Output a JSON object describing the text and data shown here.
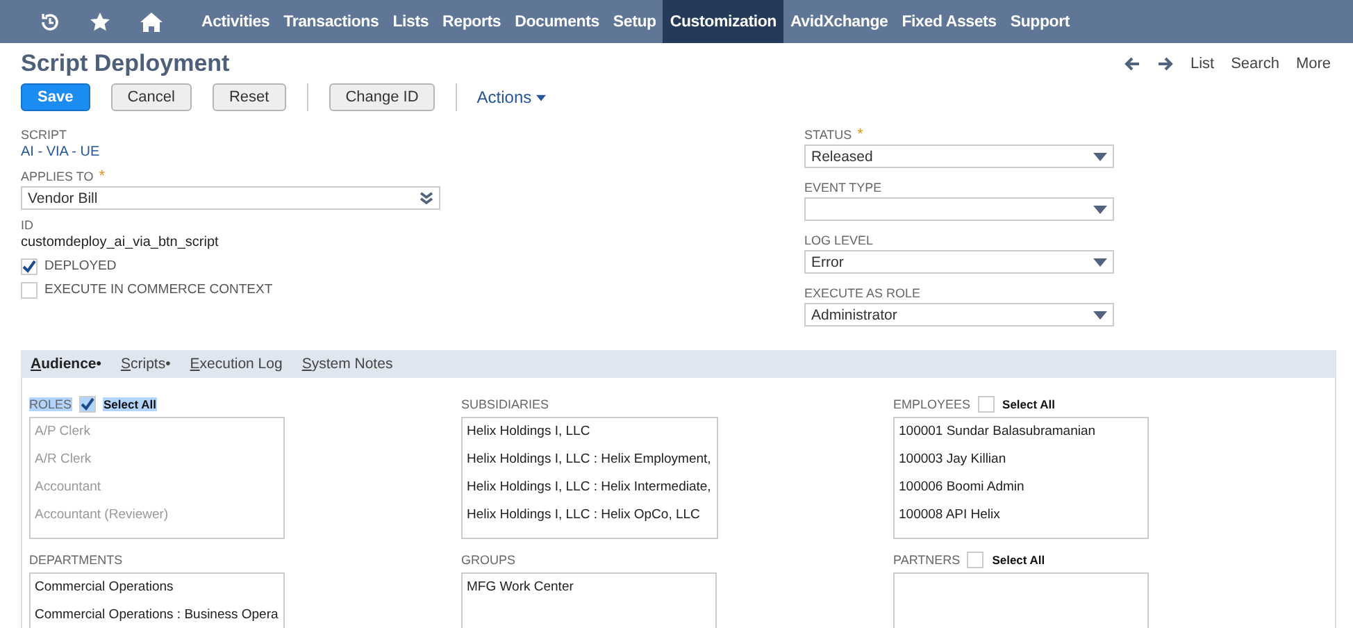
{
  "nav": {
    "items": [
      {
        "label": "Activities",
        "selected": false
      },
      {
        "label": "Transactions",
        "selected": false
      },
      {
        "label": "Lists",
        "selected": false
      },
      {
        "label": "Reports",
        "selected": false
      },
      {
        "label": "Documents",
        "selected": false
      },
      {
        "label": "Setup",
        "selected": false
      },
      {
        "label": "Customization",
        "selected": true
      },
      {
        "label": "AvidXchange",
        "selected": false
      },
      {
        "label": "Fixed Assets",
        "selected": false
      },
      {
        "label": "Support",
        "selected": false
      }
    ]
  },
  "page": {
    "title": "Script Deployment",
    "links": [
      "List",
      "Search",
      "More"
    ]
  },
  "toolbar": {
    "groups": [
      [
        {
          "label": "Save",
          "kind": "primary"
        },
        {
          "label": "Cancel",
          "kind": "default"
        },
        {
          "label": "Reset",
          "kind": "default"
        }
      ],
      [
        {
          "label": "Change ID",
          "kind": "default"
        }
      ]
    ],
    "actions": "Actions"
  },
  "left_fields": {
    "script": {
      "label": "SCRIPT",
      "value": "AI - VIA - UE"
    },
    "applies_to": {
      "label": "APPLIES TO",
      "required_mark": "*",
      "value": "Vendor Bill"
    },
    "id": {
      "label": "ID",
      "value": "customdeploy_ai_via_btn_script"
    },
    "checkboxes": [
      {
        "label": "DEPLOYED",
        "checked": true
      },
      {
        "label": "EXECUTE IN COMMERCE CONTEXT",
        "checked": false
      }
    ]
  },
  "right_fields": [
    {
      "label": "STATUS",
      "required_mark": "*",
      "value": "Released"
    },
    {
      "label": "EVENT TYPE"
    },
    {
      "label": "LOG LEVEL",
      "value": "Error"
    },
    {
      "label": "EXECUTE AS ROLE",
      "value": "Administrator"
    }
  ],
  "tabs": [
    {
      "label": "Audience",
      "dot": "•",
      "selected": true
    },
    {
      "label": "Scripts",
      "dot": "•",
      "selected": false
    },
    {
      "label": "Execution Log",
      "selected": false
    },
    {
      "label": "System Notes",
      "selected": false
    }
  ],
  "audience": {
    "columns": [
      [
        {
          "label": "ROLES",
          "highlighted": true,
          "select_all": {
            "label": "Select All",
            "checked": true
          },
          "disabled": true,
          "items": [
            "A/P Clerk",
            "A/R Clerk",
            "Accountant",
            "Accountant (Reviewer)"
          ]
        },
        {
          "label": "DEPARTMENTS",
          "highlighted": false,
          "items": [
            "Commercial Operations",
            "Commercial Operations : Business Opera"
          ]
        }
      ],
      [
        {
          "label": "SUBSIDIARIES",
          "highlighted": false,
          "items": [
            "Helix Holdings I, LLC",
            "Helix Holdings I, LLC : Helix Employment,",
            "Helix Holdings I, LLC : Helix Intermediate,",
            "Helix Holdings I, LLC : Helix OpCo, LLC"
          ]
        },
        {
          "label": "GROUPS",
          "highlighted": false,
          "items": [
            "MFG Work Center"
          ]
        }
      ],
      [
        {
          "label": "EMPLOYEES",
          "highlighted": false,
          "select_all": {
            "label": "Select All",
            "checked": false
          },
          "items": [
            "100001 Sundar Balasubramanian",
            "100003 Jay Killian",
            "100006 Boomi Admin",
            "100008 API Helix"
          ]
        },
        {
          "label": "PARTNERS",
          "highlighted": false,
          "select_all": {
            "label": "Select All",
            "checked": false
          }
        }
      ]
    ]
  }
}
